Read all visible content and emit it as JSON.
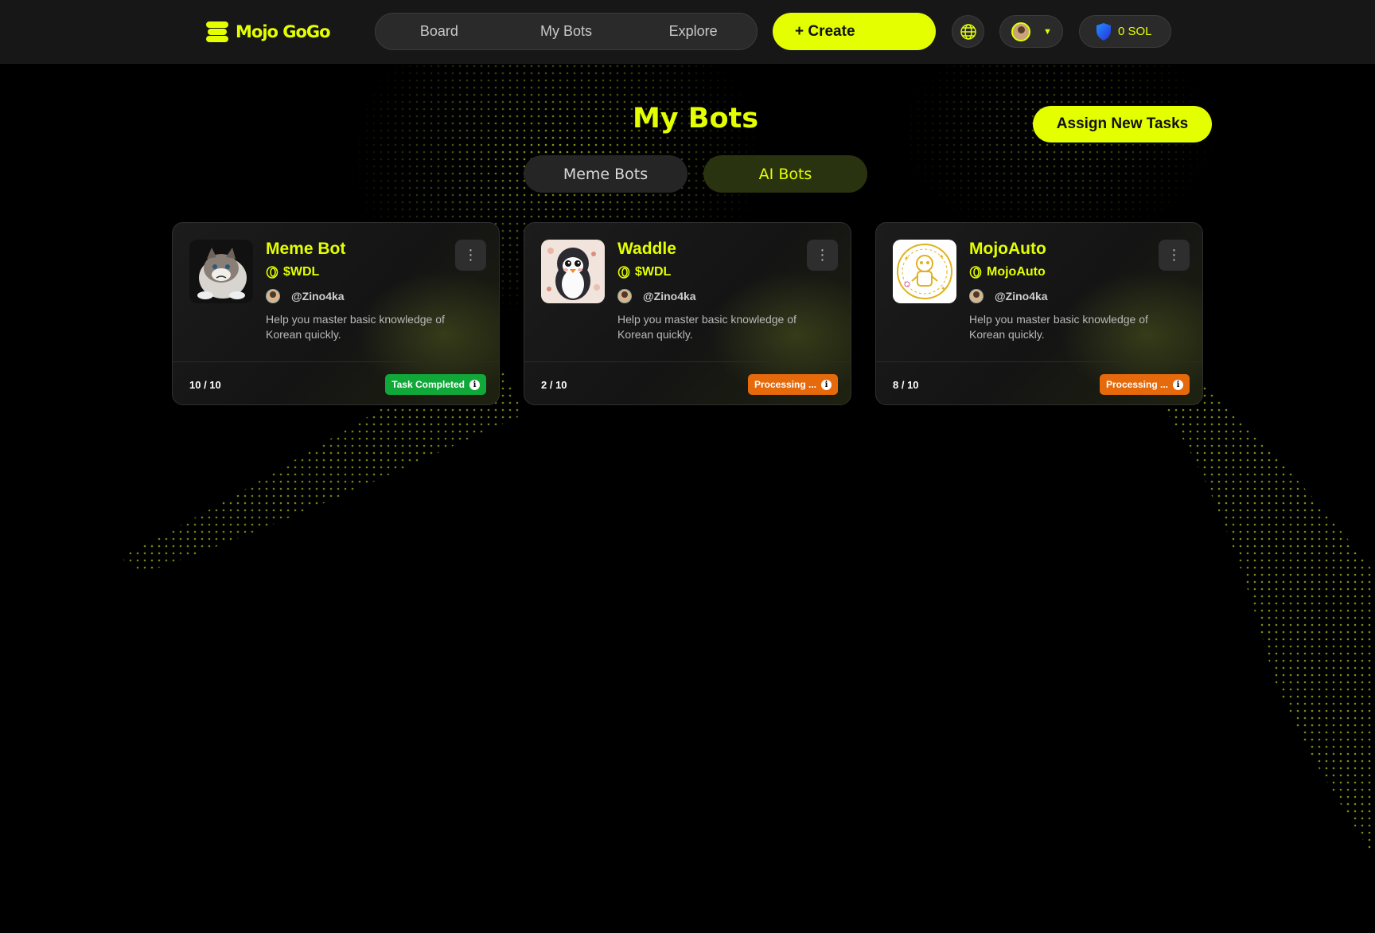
{
  "header": {
    "logo_text": "Mojo GoGo",
    "nav": [
      {
        "label": "Board"
      },
      {
        "label": "My Bots"
      },
      {
        "label": "Explore"
      }
    ],
    "create_label": "+ Create",
    "wallet_amount": "0 SOL",
    "icons": [
      "logo-icon",
      "globe-icon",
      "avatar",
      "chevron-down-icon",
      "shield-icon"
    ]
  },
  "page": {
    "title": "My Bots",
    "assign_label": "Assign New Tasks",
    "tabs": [
      {
        "label": "Meme Bots",
        "active": false
      },
      {
        "label": "AI Bots",
        "active": true
      }
    ]
  },
  "cards": [
    {
      "name": "Meme Bot",
      "token": "$WDL",
      "author": "@Zino4ka",
      "description": "Help you master basic knowledge of Korean quickly.",
      "progress": "10 / 10",
      "status": "Task Completed",
      "status_color": "#11a83a",
      "thumb": "grumpy-cat-image"
    },
    {
      "name": "Waddle",
      "token": "$WDL",
      "author": "@Zino4ka",
      "description": "Help you master basic knowledge of Korean quickly.",
      "progress": "2 / 10",
      "status": "Processing ...",
      "status_color": "#e66a0c",
      "thumb": "penguin-image"
    },
    {
      "name": "MojoAuto",
      "token": "MojoAuto",
      "author": "@Zino4ka",
      "description": "Help you master basic knowledge of Korean quickly.",
      "progress": "8 / 10",
      "status": "Processing ...",
      "status_color": "#e66a0c",
      "thumb": "mojo-robot-image"
    }
  ],
  "colors": {
    "accent": "#e3ff00",
    "background": "#000000",
    "card": "#181818"
  }
}
